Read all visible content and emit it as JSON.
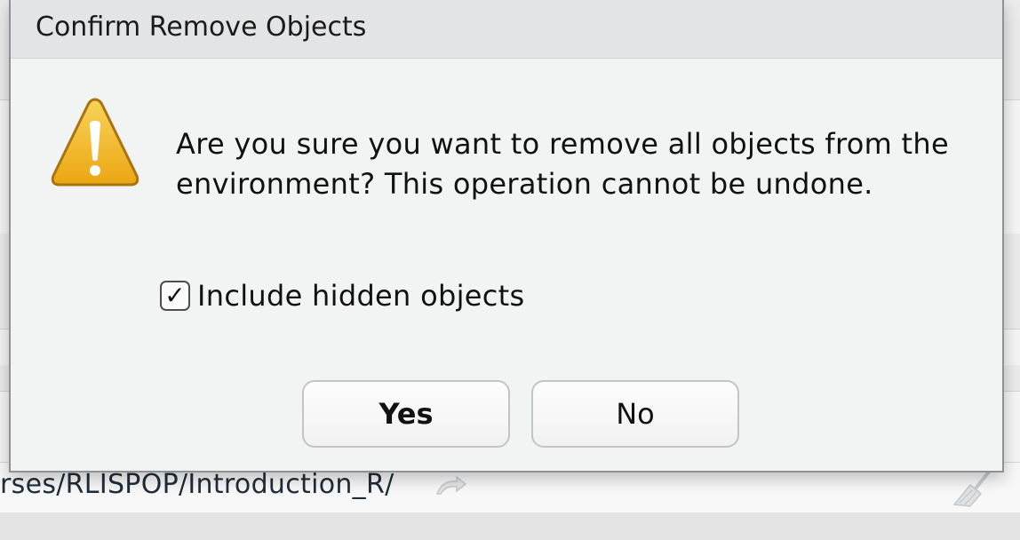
{
  "dialog": {
    "title": "Confirm Remove Objects",
    "message": "Are you sure you want to remove all objects from the environment? This operation cannot be undone.",
    "checkbox": {
      "label": "Include hidden objects",
      "checked": true,
      "mark": "✓"
    },
    "buttons": {
      "yes": "Yes",
      "no": "No"
    },
    "icon": "warning-icon"
  },
  "background": {
    "path_text": "rses/RLISPOP/Introduction_R/",
    "icons": [
      "go-to-directory-icon",
      "broom-icon"
    ]
  },
  "colors": {
    "warning_fill": "#f2b21e",
    "warning_stroke": "#b07a10",
    "dialog_bg": "#f2f3f3",
    "titlebar_bg": "#e3e4e6"
  }
}
